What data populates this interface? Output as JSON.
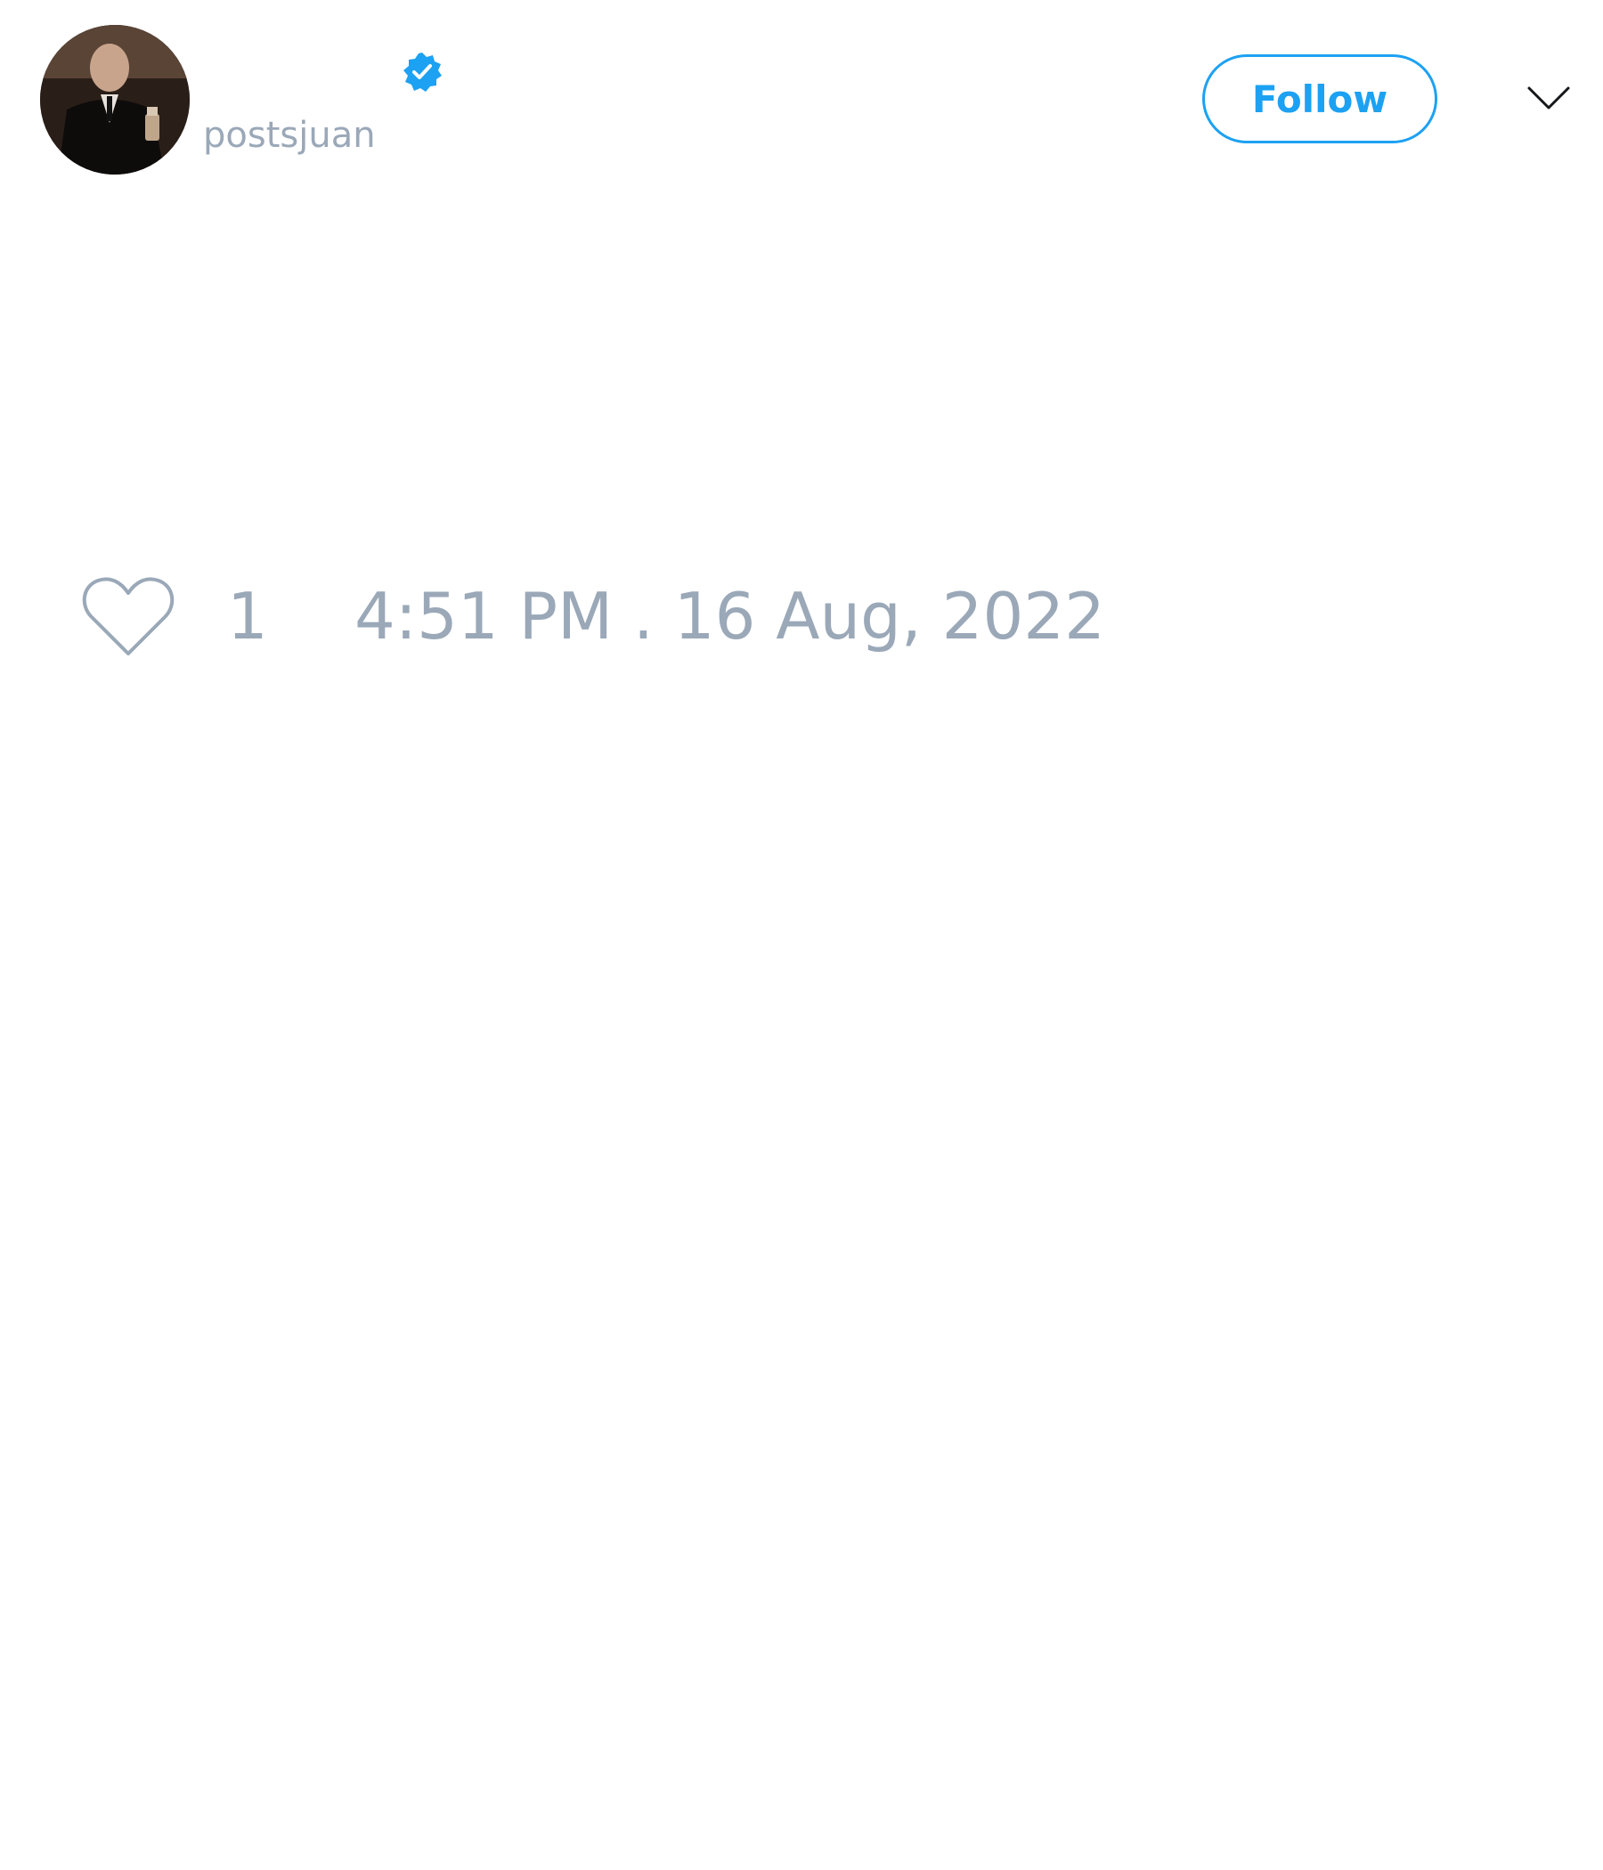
{
  "tweet": {
    "author": {
      "display_name": "",
      "username": "postsjuan",
      "verified": true
    },
    "follow_label": "Follow",
    "likes": "1",
    "timestamp": "4:51 PM . 16 Aug, 2022"
  },
  "colors": {
    "accent": "#1da1f2",
    "muted_text": "#9aa8b8",
    "background": "#ffffff"
  },
  "icons": {
    "verified": "verified-badge-icon",
    "menu": "chevron-down-icon",
    "like": "heart-icon"
  }
}
